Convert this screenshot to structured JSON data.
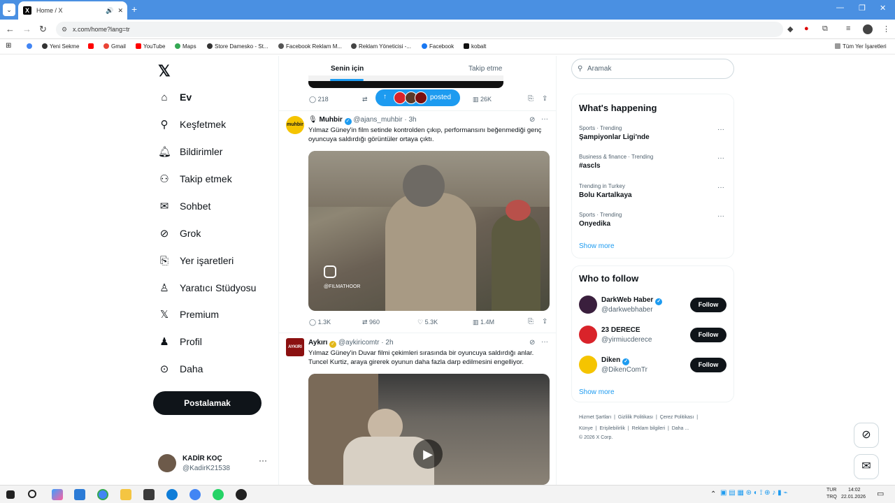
{
  "browser": {
    "tab_title": "Home / X",
    "url": "x.com/home?lang=tr",
    "bookmarks": [
      "Yeni Sekme",
      "YouTube",
      "Gmail",
      "YouTube",
      "Maps",
      "Store Damesko - St...",
      "Facebook Reklam M...",
      "Reklam Yöneticisi -...",
      "Facebook",
      "kobalt"
    ],
    "all_bookmarks": "Tüm Yer İşaretleri"
  },
  "nav": {
    "items": [
      {
        "label": "Ev",
        "icon": "home-icon"
      },
      {
        "label": "Keşfetmek",
        "icon": "search-icon"
      },
      {
        "label": "Bildirimler",
        "icon": "bell-icon"
      },
      {
        "label": "Takip etmek",
        "icon": "follow-icon"
      },
      {
        "label": "Sohbet",
        "icon": "mail-icon"
      },
      {
        "label": "Grok",
        "icon": "grok-icon"
      },
      {
        "label": "Yer işaretleri",
        "icon": "bookmark-icon"
      },
      {
        "label": "Yaratıcı Stüdyosu",
        "icon": "studio-icon"
      },
      {
        "label": "Premium",
        "icon": "x-icon"
      },
      {
        "label": "Profil",
        "icon": "profile-icon"
      },
      {
        "label": "Daha",
        "icon": "more-icon"
      }
    ],
    "post_button": "Postalamak",
    "profile": {
      "name": "KADİR KOÇ",
      "handle": "@KadirK21538"
    }
  },
  "feed": {
    "tabs": [
      "Senin için",
      "Takip etme"
    ],
    "new_posts_pill": "posted",
    "top_actions": {
      "replies": "218",
      "views": "26K"
    },
    "posts": [
      {
        "name": "Muhbir",
        "handle": "@ajans_muhbir",
        "time": "3h",
        "text": "Yılmaz Güney'in film setinde kontrolden çıkıp, performansını beğenmediği genç oyuncuya saldırdığı görüntüler ortaya çıktı.",
        "watermark": "@FILMATHOOR",
        "replies": "1.3K",
        "reposts": "960",
        "likes": "5.3K",
        "views": "1.4M"
      },
      {
        "name": "Aykırı",
        "handle": "@aykiricomtr",
        "time": "2h",
        "text": "Yılmaz Güney'in Duvar filmi çekimleri sırasında bir oyuncuya saldırdığı anlar. Tuncel Kurtiz, araya girerek oyunun daha fazla darp edilmesini engelliyor."
      }
    ]
  },
  "right": {
    "search_placeholder": "Aramak",
    "happening_title": "What's happening",
    "trends": [
      {
        "meta": "Sports · Trending",
        "name": "Şampiyonlar Ligi'nde"
      },
      {
        "meta": "Business & finance · Trending",
        "name": "#ascls"
      },
      {
        "meta": "Trending in Turkey",
        "name": "Bolu Kartalkaya"
      },
      {
        "meta": "Sports · Trending",
        "name": "Onyedika"
      }
    ],
    "show_more": "Show more",
    "wtf_title": "Who to follow",
    "who_to_follow": [
      {
        "name": "DarkWeb Haber",
        "handle": "@darkwebhaber",
        "color": "#3a1f3d",
        "verified": true
      },
      {
        "name": "23 DERECE",
        "handle": "@yirmiucderece",
        "color": "#d9232a",
        "verified": false
      },
      {
        "name": "Diken",
        "handle": "@DikenComTr",
        "color": "#f5c400",
        "verified": true
      }
    ],
    "follow_label": "Follow",
    "footer_line1": [
      "Hizmet Şartları",
      "Gizlilik Politikası",
      "Çerez Politikası"
    ],
    "footer_line2": [
      "Künye",
      "Erişilebilirlik",
      "Reklam bilgileri",
      "Daha ..."
    ],
    "copyright": "© 2026 X Corp."
  },
  "taskbar": {
    "lang1": "TUR",
    "lang2": "TRQ",
    "time": "14:02",
    "date": "22.01.2026"
  },
  "colors": {
    "accent": "#1d9bf0",
    "chrome_blue": "#4a90e2",
    "text": "#0f1419",
    "muted": "#536471"
  }
}
